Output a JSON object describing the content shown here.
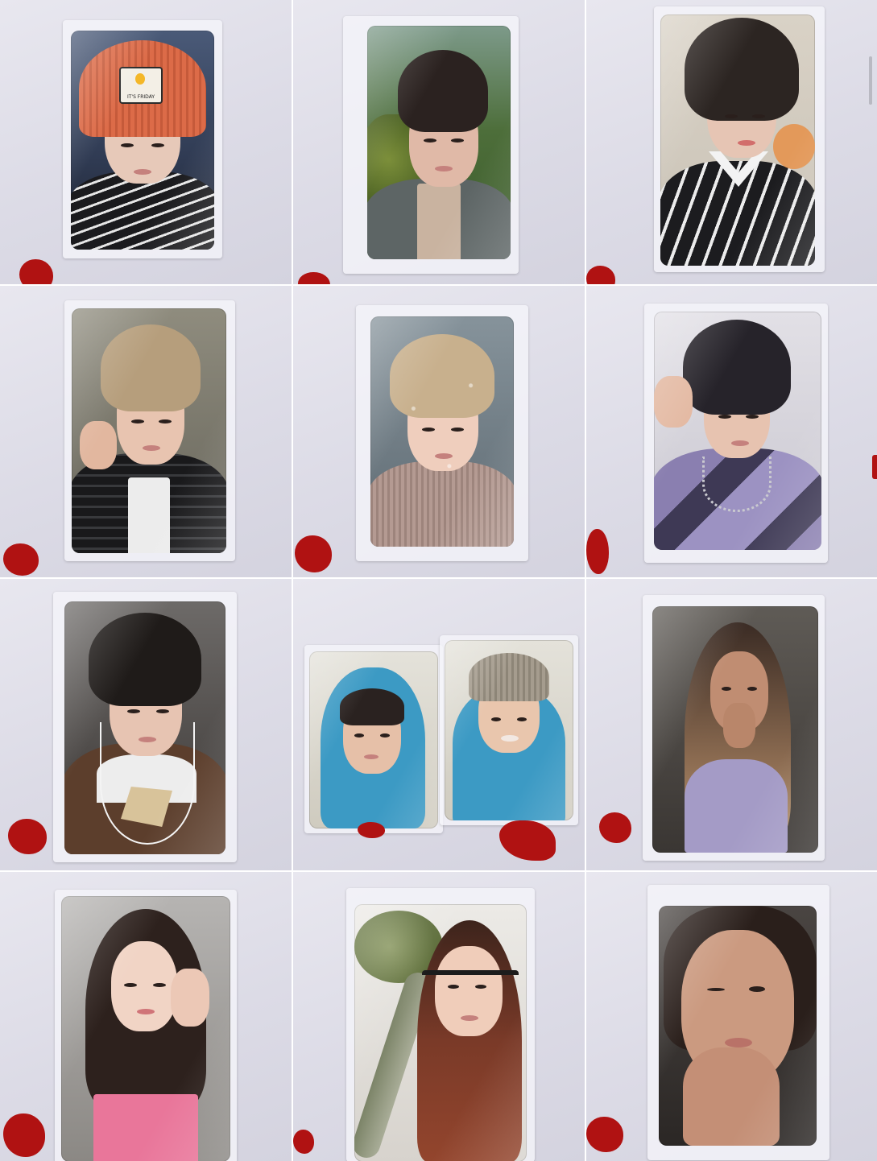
{
  "photocards": [
    {
      "position": "row1-col1",
      "caption_on_beanie": "IT'S FRIDAY"
    },
    {
      "position": "row1-col2"
    },
    {
      "position": "row1-col3"
    },
    {
      "position": "row2-col1"
    },
    {
      "position": "row2-col2"
    },
    {
      "position": "row2-col3"
    },
    {
      "position": "row3-col1"
    },
    {
      "position": "row3-col2",
      "cards_in_sleeve": 2
    },
    {
      "position": "row3-col3"
    },
    {
      "position": "row4-col1"
    },
    {
      "position": "row4-col2"
    },
    {
      "position": "row4-col3"
    }
  ],
  "colors": {
    "background": "#dcdbe6",
    "marker_red": "#b01212"
  }
}
